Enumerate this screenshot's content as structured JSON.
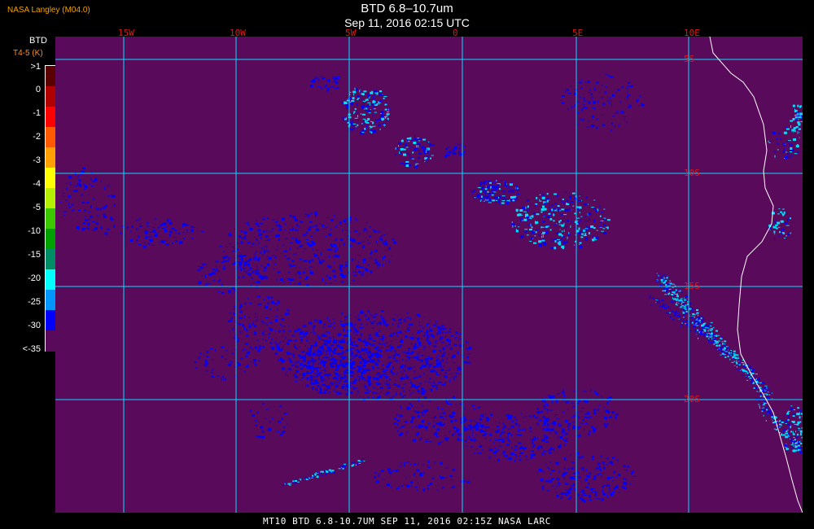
{
  "header": {
    "provider": "NASA Langley (M04.0)",
    "title": "BTD 6.8–10.7um",
    "subtitle": "Sep 11, 2016 02:15 UTC"
  },
  "colorbar": {
    "title_line1": "BTD",
    "title_line2": "T4-5 (K)",
    "labels": [
      ">1",
      "0",
      "-1",
      "-2",
      "-3",
      "-4",
      "-5",
      "-10",
      "-15",
      "-20",
      "-25",
      "-30",
      "<-35"
    ],
    "colors": [
      "#5a0000",
      "#b00000",
      "#ff0000",
      "#ff5a00",
      "#ffa000",
      "#ffff00",
      "#b4f000",
      "#3cc800",
      "#00a000",
      "#008c64",
      "#00ffff",
      "#0096ff",
      "#0000ff",
      "#5a0a5a"
    ]
  },
  "map": {
    "background": "#5a0a5a",
    "grid_color": "#00e0ff",
    "echo_color": "#0000ff",
    "bright_color": "#00e0ff",
    "lon_labels": [
      "15W",
      "10W",
      "5W",
      "0",
      "5E",
      "10E"
    ],
    "lat_labels": [
      "5S",
      "10S",
      "15S",
      "20S"
    ]
  },
  "footer": {
    "text": "MT10  BTD 6.8-10.7UM   SEP 11, 2016 02:15Z   NASA LARC"
  }
}
